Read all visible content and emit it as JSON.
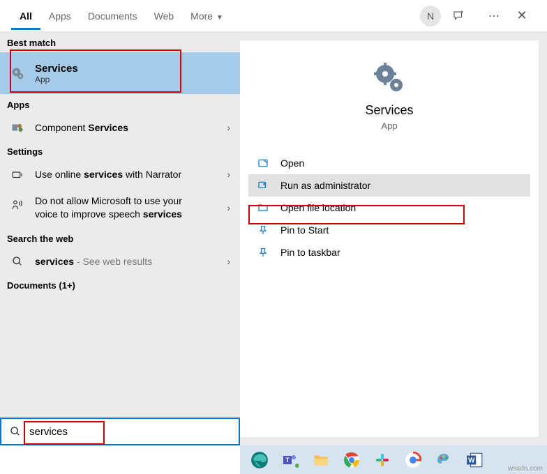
{
  "tabs": {
    "all": "All",
    "apps": "Apps",
    "documents": "Documents",
    "web": "Web",
    "more": "More"
  },
  "user_initial": "N",
  "left": {
    "best_match_header": "Best match",
    "best_match": {
      "title": "Services",
      "sub": "App"
    },
    "apps_header": "Apps",
    "component_services_pre": "Component ",
    "component_services_bold": "Services",
    "settings_header": "Settings",
    "setting1_pre": "Use online ",
    "setting1_bold": "services",
    "setting1_post": " with Narrator",
    "setting2_line1": "Do not allow Microsoft to use your",
    "setting2_line2_pre": "voice to improve speech ",
    "setting2_line2_bold": "services",
    "searchweb_header": "Search the web",
    "web_bold": "services",
    "web_post": " - See web results",
    "documents_header": "Documents (1+)"
  },
  "right": {
    "app_name": "Services",
    "app_type": "App",
    "actions": {
      "open": "Open",
      "run_admin": "Run as administrator",
      "open_loc": "Open file location",
      "pin_start": "Pin to Start",
      "pin_taskbar": "Pin to taskbar"
    }
  },
  "search": {
    "value": "services"
  },
  "watermark": "wsxdn.com"
}
